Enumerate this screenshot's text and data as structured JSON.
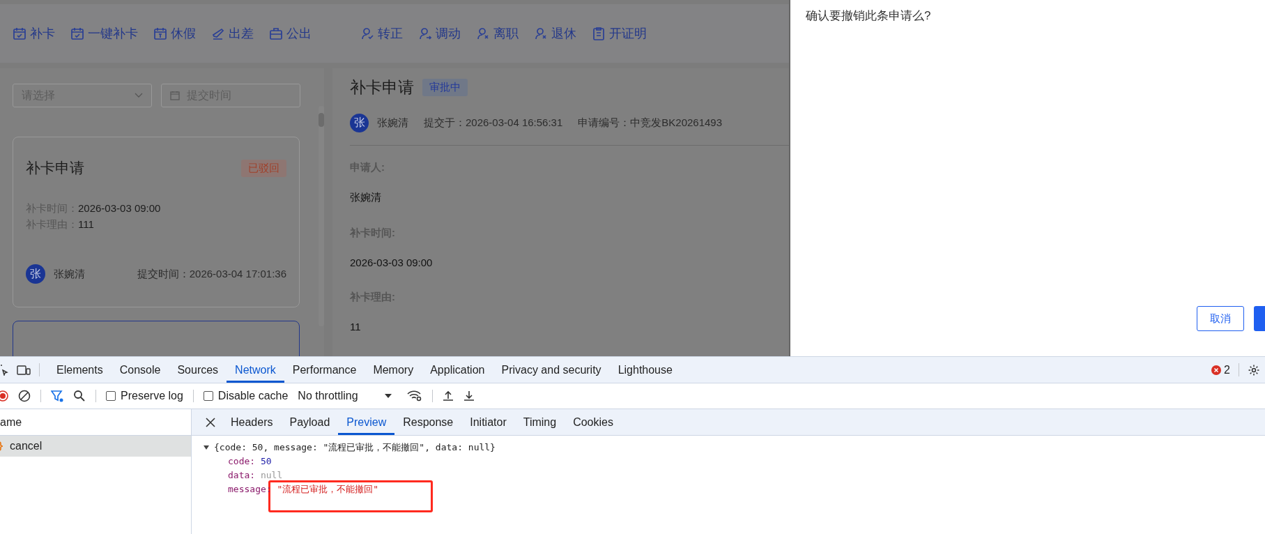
{
  "toolbar": {
    "groups": [
      {
        "items": [
          {
            "label": "补卡"
          },
          {
            "label": "一键补卡"
          },
          {
            "label": "休假"
          },
          {
            "label": "出差"
          },
          {
            "label": "公出"
          }
        ]
      },
      {
        "items": [
          {
            "label": "转正"
          },
          {
            "label": "调动"
          },
          {
            "label": "离职"
          },
          {
            "label": "退休"
          },
          {
            "label": "开证明"
          }
        ]
      }
    ]
  },
  "filters": {
    "status": {
      "placeholder": "请选择"
    },
    "date": {
      "placeholder": "提交时间"
    }
  },
  "list": {
    "cards": [
      {
        "title": "补卡申请",
        "status": "已驳回",
        "fields": [
          {
            "label": "补卡时间：",
            "value": "2026-03-03 09:00"
          },
          {
            "label": "补卡理由：",
            "value": "111"
          }
        ],
        "avatar": "张",
        "name": "张婉清",
        "submitted": "提交时间：2026-03-04 17:01:36",
        "selected": false
      },
      {
        "selected": true
      }
    ]
  },
  "detail": {
    "title": "补卡申请",
    "status": "审批中",
    "avatar": "张",
    "name": "张婉清",
    "submitted": "提交于：2026-03-04 16:56:31",
    "number": "申请编号：中竞发BK20261493",
    "fields": [
      {
        "label": "申请人:",
        "value": "张婉清"
      },
      {
        "label": "补卡时间:",
        "value": "2026-03-03 09:00"
      },
      {
        "label": "补卡理由:",
        "value": "11"
      }
    ]
  },
  "dialog": {
    "message": "确认要撤销此条申请么?",
    "buttons": [
      {
        "label": "取消",
        "kind": "secondary"
      },
      {
        "kind": "primary"
      }
    ]
  },
  "devtools": {
    "tabs": [
      {
        "label": "Elements",
        "selected": false
      },
      {
        "label": "Console",
        "selected": false
      },
      {
        "label": "Sources",
        "selected": false
      },
      {
        "label": "Network",
        "selected": true
      },
      {
        "label": "Performance",
        "selected": false
      },
      {
        "label": "Memory",
        "selected": false
      },
      {
        "label": "Application",
        "selected": false
      },
      {
        "label": "Privacy and security",
        "selected": false
      },
      {
        "label": "Lighthouse",
        "selected": false
      }
    ],
    "error_count": "2",
    "network_toolbar": {
      "preserve_log": {
        "label": "Preserve log",
        "checked": false
      },
      "disable_cache": {
        "label": "Disable cache",
        "checked": false
      },
      "throttling": "No throttling"
    },
    "requests": {
      "header": "ame",
      "rows": [
        {
          "name": "cancel",
          "selected": true
        }
      ]
    },
    "detail_tabs": [
      {
        "label": "Headers",
        "selected": false
      },
      {
        "label": "Payload",
        "selected": false
      },
      {
        "label": "Preview",
        "selected": true
      },
      {
        "label": "Response",
        "selected": false
      },
      {
        "label": "Initiator",
        "selected": false
      },
      {
        "label": "Timing",
        "selected": false
      },
      {
        "label": "Cookies",
        "selected": false
      }
    ],
    "preview": {
      "summary": "{code: 50, message: \"流程已审批，不能撤回\", data: null}",
      "expanded": true,
      "properties": [
        {
          "key": "code:",
          "value": "50",
          "kind": "number"
        },
        {
          "key": "data:",
          "value": "null",
          "kind": "null"
        },
        {
          "key": "message:",
          "value": "\"流程已审批，不能撤回\"",
          "kind": "string"
        }
      ]
    }
  }
}
